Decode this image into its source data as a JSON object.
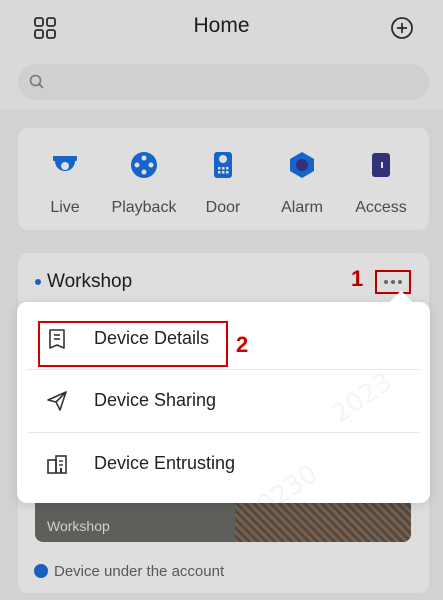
{
  "header": {
    "title": "Home",
    "grid_icon": "grid-icon",
    "add_icon": "plus-circle-icon"
  },
  "search": {
    "placeholder": ""
  },
  "quick_access": {
    "items": [
      {
        "label": "Live",
        "icon": "dome-camera-icon"
      },
      {
        "label": "Playback",
        "icon": "playback-icon"
      },
      {
        "label": "Door",
        "icon": "door-station-icon"
      },
      {
        "label": "Alarm",
        "icon": "alarm-icon"
      },
      {
        "label": "Access",
        "icon": "access-icon"
      }
    ]
  },
  "device_card": {
    "name": "Workshop",
    "thumbnail_label": "Workshop",
    "footer": "Device under the account",
    "step_marker": "1"
  },
  "menu": {
    "step_marker": "2",
    "items": [
      {
        "label": "Device Details",
        "icon": "document-icon"
      },
      {
        "label": "Device Sharing",
        "icon": "send-icon"
      },
      {
        "label": "Device Entrusting",
        "icon": "building-icon"
      }
    ]
  },
  "colors": {
    "accent": "#1f6fd8",
    "highlight": "#d10000",
    "icon_blue": "#1a73e8",
    "icon_purple": "#3a3a8c"
  }
}
